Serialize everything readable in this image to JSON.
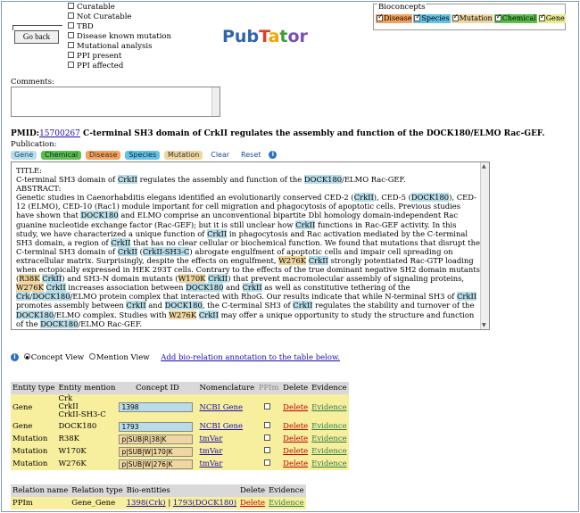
{
  "header": {
    "back_label": "Go back",
    "curation_options": [
      {
        "label": "Curatable",
        "checked": false
      },
      {
        "label": "Not Curatable",
        "checked": false
      },
      {
        "label": "TBD",
        "checked": false
      },
      {
        "label": "Disease known mutation",
        "checked": false
      },
      {
        "label": "Mutational analysis",
        "checked": false
      },
      {
        "label": "PPI present",
        "checked": false
      },
      {
        "label": "PPI affected",
        "checked": false
      }
    ],
    "logo": {
      "p1": "Pub",
      "p2": "T",
      "p3": "a",
      "p4": "t",
      "p5": "or"
    }
  },
  "bioconcepts": {
    "legend": "Bioconcepts",
    "items": [
      {
        "label": "Disease",
        "checked": true,
        "color": "#f7a25c"
      },
      {
        "label": "Species",
        "checked": true,
        "color": "#62c3e8"
      },
      {
        "label": "Mutation",
        "checked": true,
        "color": "#f0d6a0"
      },
      {
        "label": "Chemical",
        "checked": true,
        "color": "#5cc04c"
      },
      {
        "label": "Gene",
        "checked": true,
        "color": "#e8ec8c"
      }
    ]
  },
  "comments": {
    "label": "Comments:",
    "value": ""
  },
  "article": {
    "pmid_label": "PMID:",
    "pmid": "15700267",
    "title": "C-terminal SH3 domain of CrkII regulates the assembly and function of the DOCK180/ELMO Rac-GEF.",
    "publication_label": "Publication:"
  },
  "type_buttons": {
    "gene": "Gene",
    "chemical": "Chemical",
    "disease": "Disease",
    "species": "Species",
    "mutation": "Mutation",
    "clear": "Clear",
    "reset": "Reset"
  },
  "text": {
    "title_label": "TITLE:",
    "abstract_label": "ABSTRACT:"
  },
  "view": {
    "concept": "Concept View",
    "mention": "Mention View",
    "selected": "concept",
    "add_link": "Add bio-relation annotation to the table below."
  },
  "entity_table": {
    "headers": [
      "Entity type",
      "Entity mention",
      "Concept ID",
      "Nomenclature",
      "PPIm",
      "Delete",
      "Evidence"
    ],
    "rows": [
      {
        "type": "Gene",
        "mentions": [
          "Crk",
          "CrkII",
          "CrkII-SH3-C"
        ],
        "concept_id": "1398",
        "nomenclature": "NCBI Gene",
        "delete": "Delete",
        "evidence": "Evidence"
      },
      {
        "type": "Gene",
        "mentions": [
          "DOCK180"
        ],
        "concept_id": "1793",
        "nomenclature": "NCBI Gene",
        "delete": "Delete",
        "evidence": "Evidence"
      },
      {
        "type": "Mutation",
        "mentions": [
          "R38K"
        ],
        "concept_id": "p|SUB|R|38|K",
        "nomenclature": "tmVar",
        "delete": "Delete",
        "evidence": "Evidence"
      },
      {
        "type": "Mutation",
        "mentions": [
          "W170K"
        ],
        "concept_id": "p|SUB|W|170|K",
        "nomenclature": "tmVar",
        "delete": "Delete",
        "evidence": "Evidence"
      },
      {
        "type": "Mutation",
        "mentions": [
          "W276K"
        ],
        "concept_id": "p|SUB|W|276|K",
        "nomenclature": "tmVar",
        "delete": "Delete",
        "evidence": "Evidence"
      }
    ]
  },
  "relation_table": {
    "headers": [
      "Relation name",
      "Relation type",
      "Bio-entities",
      "Delete",
      "Evidence"
    ],
    "rows": [
      {
        "name": "PPIm",
        "type": "Gene_Gene",
        "e1": "1398(Crk)",
        "sep": "|",
        "e2": "1793(DOCK180)",
        "delete": "Delete",
        "evidence": "Evidence"
      }
    ]
  }
}
